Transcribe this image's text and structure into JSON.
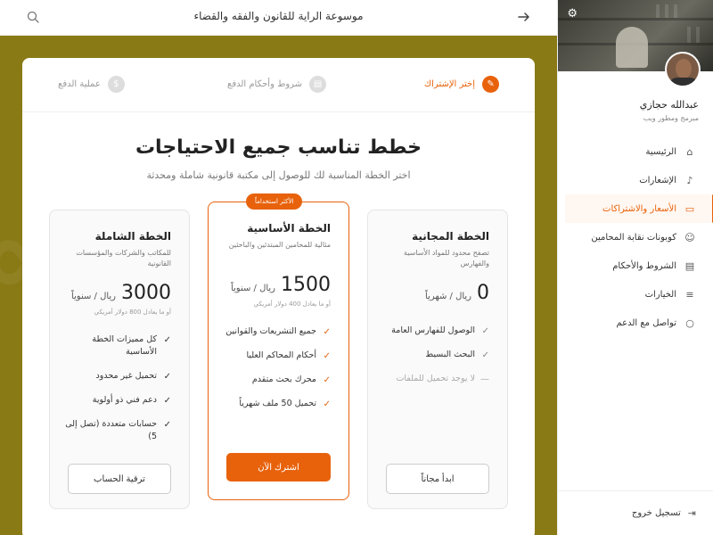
{
  "topbar": {
    "title": "موسوعة الراية للقانون والفقه والقضاء",
    "back_icon": "arrow-right-icon",
    "search_icon": "search-icon"
  },
  "steps": [
    {
      "label": "إختر الإشتراك",
      "icon": "pencil-icon",
      "active": true
    },
    {
      "label": "شروط وأحكام الدفع",
      "icon": "document-icon",
      "active": false
    },
    {
      "label": "عملية الدفع",
      "icon": "dollar-icon",
      "active": false
    }
  ],
  "heading": "خطط تناسب جميع الاحتياجات",
  "subheading": "اختر الخطة المناسبة لك للوصول إلى مكتبة قانونية شاملة ومحدثة",
  "plans": {
    "free": {
      "title": "الخطة المجانية",
      "desc": "تصفح محدود للمواد الأساسية والفهارس",
      "amount": "0",
      "unit": "ريال / شهرياً",
      "note": "",
      "features": [
        {
          "text": "الوصول للفهارس العامة",
          "enabled": true
        },
        {
          "text": "البحث البسيط",
          "enabled": true
        },
        {
          "text": "لا يوجد تحميل للملفات",
          "enabled": false
        }
      ],
      "button": "ابدأ مجاناً"
    },
    "basic": {
      "badge": "الأكثر استخداماً",
      "title": "الخطة الأساسية",
      "desc": "مثالية للمحامين المبتدئين والباحثين",
      "amount": "1500",
      "unit": "ريال / سنوياً",
      "note": "أو ما يعادل 400 دولار أمريكي",
      "features": [
        {
          "text": "جميع التشريعات والقوانين",
          "enabled": true
        },
        {
          "text": "أحكام المحاكم العليا",
          "enabled": true
        },
        {
          "text": "محرك بحث متقدم",
          "enabled": true
        },
        {
          "text": "تحميل 50 ملف شهرياً",
          "enabled": true
        }
      ],
      "button": "اشترك الآن"
    },
    "full": {
      "title": "الخطة الشاملة",
      "desc": "للمكاتب والشركات والمؤسسات القانونية",
      "amount": "3000",
      "unit": "ريال / سنوياً",
      "note": "أو ما يعادل 800 دولار أمريكي",
      "features": [
        {
          "text": "كل مميزات الخطة الأساسية",
          "enabled": true
        },
        {
          "text": "تحميل غير محدود",
          "enabled": true
        },
        {
          "text": "دعم فني ذو أولوية",
          "enabled": true
        },
        {
          "text": "حسابات متعددة (تصل إلى 5)",
          "enabled": true
        }
      ],
      "button": "ترقية الحساب"
    }
  },
  "sidebar": {
    "settings_icon": "gear-icon",
    "user_name": "عبدالله حجازي",
    "user_role": "مبرمج ومطور ويب",
    "items": [
      {
        "label": "الرئيسية",
        "icon": "home-icon",
        "active": false
      },
      {
        "label": "الإشعارات",
        "icon": "bell-icon",
        "active": false
      },
      {
        "label": "الأسعار والاشتراكات",
        "icon": "credit-card-icon",
        "active": true
      },
      {
        "label": "كوبونات نقابة المحامين",
        "icon": "users-icon",
        "active": false
      },
      {
        "label": "الشروط والأحكام",
        "icon": "document-icon",
        "active": false
      },
      {
        "label": "الخيارات",
        "icon": "sliders-icon",
        "active": false
      },
      {
        "label": "تواصل مع الدعم",
        "icon": "chat-icon",
        "active": false
      }
    ],
    "logout": "تسجيل خروج",
    "logout_icon": "logout-icon"
  },
  "colors": {
    "accent": "#e8620c",
    "background": "#8a7a16"
  }
}
